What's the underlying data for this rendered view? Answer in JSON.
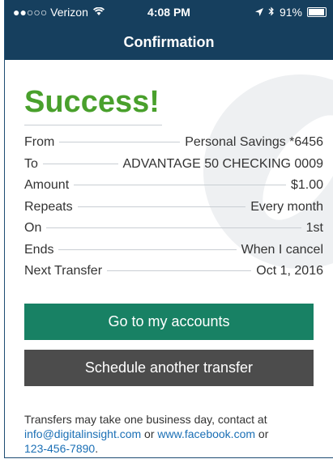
{
  "status_bar": {
    "carrier": "●●○○○ Verizon",
    "time": "4:08 PM",
    "battery": "91%"
  },
  "nav": {
    "title": "Confirmation"
  },
  "heading": "Success!",
  "details": [
    {
      "label": "From",
      "value": "Personal Savings *6456"
    },
    {
      "label": "To",
      "value": "ADVANTAGE 50 CHECKING 0009"
    },
    {
      "label": "Amount",
      "value": "$1.00"
    },
    {
      "label": "Repeats",
      "value": "Every month"
    },
    {
      "label": "On",
      "value": "1st"
    },
    {
      "label": "Ends",
      "value": "When I cancel"
    },
    {
      "label": "Next Transfer",
      "value": "Oct 1, 2016"
    }
  ],
  "buttons": {
    "primary": "Go to my accounts",
    "secondary": "Schedule another transfer"
  },
  "footer": {
    "text_before": "Transfers may take one business day, contact at",
    "email": "info@digitalinsight.com",
    "or1": " or ",
    "facebook": "www.facebook.com",
    "or2": " or",
    "phone": "123-456-7890",
    "period": "."
  },
  "colors": {
    "nav_bg": "#163f5e",
    "success": "#49a02c",
    "primary_btn": "#188164",
    "secondary_btn": "#4c4c4c",
    "link": "#1a6fb5"
  }
}
